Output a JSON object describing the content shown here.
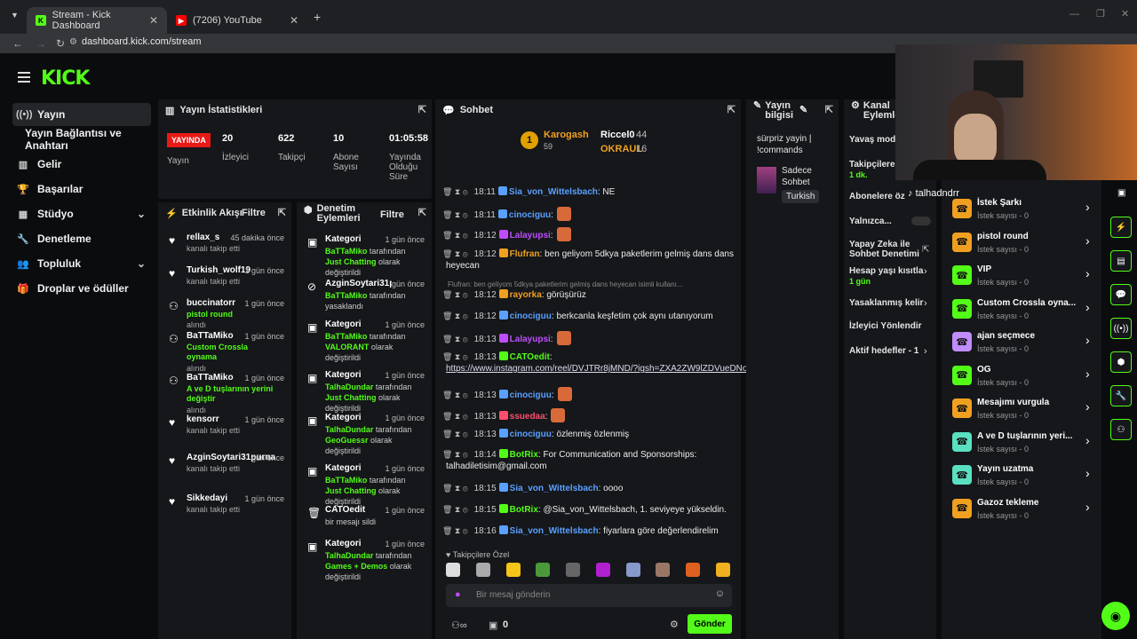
{
  "browser": {
    "tabs": [
      {
        "title": "Stream - Kick Dashboard"
      },
      {
        "title": "(7206) YouTube"
      }
    ],
    "url": "dashboard.kick.com/stream"
  },
  "brand": {
    "logo": "KICK",
    "accent": "#53fc18"
  },
  "nav": {
    "items": [
      {
        "label": "Yayın",
        "icon": "broadcast-icon"
      },
      {
        "label": "Yayın Bağlantısı ve Anahtarı"
      },
      {
        "label": "Gelir",
        "icon": "revenue-icon"
      },
      {
        "label": "Başarılar",
        "icon": "trophy-icon"
      },
      {
        "label": "Stüdyo",
        "icon": "studio-icon"
      },
      {
        "label": "Denetleme",
        "icon": "wrench-icon"
      },
      {
        "label": "Topluluk",
        "icon": "community-icon"
      },
      {
        "label": "Droplar ve ödüller",
        "icon": "gift-icon"
      }
    ]
  },
  "stats": {
    "title": "Yayın İstatistikleri",
    "live_label": "YAYINDA",
    "live_sub": "Yayın",
    "viewers": "20",
    "viewers_label": "İzleyici",
    "followers": "622",
    "followers_label": "Takipçi",
    "subs": "10",
    "subs_label": "Abone Sayısı",
    "uptime": "01:05:58",
    "uptime_label": "Yayında Olduğu Süre"
  },
  "activity": {
    "title": "Etkinlik Akışı",
    "filter": "Filtre",
    "items": [
      {
        "name": "rellax_s",
        "time": "45 dakika önce",
        "sub": "kanalı takip etti"
      },
      {
        "name": "Turkish_wolf19",
        "time": "1 gün önce",
        "sub": "kanalı takip etti"
      },
      {
        "name": "buccinatorr",
        "time": "1 gün önce",
        "reward": "pistol round",
        "sub": "alındı"
      },
      {
        "name": "BaTTaMiko",
        "time": "1 gün önce",
        "reward": "Custom Crossla oynama",
        "sub": "alındı"
      },
      {
        "name": "BaTTaMiko",
        "time": "1 gün önce",
        "reward": "A ve D tuşlarının yerini değiştir",
        "sub": "alındı"
      },
      {
        "name": "kensorr",
        "time": "1 gün önce",
        "sub": "kanalı takip etti"
      },
      {
        "name": "AzginSoytari31purna",
        "time": "gün önce",
        "sub": "kanalı takip etti"
      },
      {
        "name": "Sikkedayi",
        "time": "1 gün önce",
        "sub": "kanalı takip etti"
      }
    ]
  },
  "moderation": {
    "title": "Denetim Eylemleri",
    "filter": "Filtre",
    "items": [
      {
        "title": "Kategori",
        "time": "1 gün önce",
        "who": "BaTTaMiko",
        "mid": " tarafından ",
        "val": "Just Chatting",
        "end": " olarak değiştirildi"
      },
      {
        "title": "AzginSoytari31purna",
        "time": "gün önce",
        "who": "BaTTaMiko",
        "mid": " tarafından yasaklandı",
        "val": "",
        "end": ""
      },
      {
        "title": "Kategori",
        "time": "1 gün önce",
        "who": "BaTTaMiko",
        "mid": " tarafından ",
        "val": "VALORANT",
        "end": " olarak değiştirildi"
      },
      {
        "title": "Kategori",
        "time": "1 gün önce",
        "who": "TalhaDundar",
        "mid": " tarafından ",
        "val": "Just Chatting",
        "end": " olarak değiştirildi"
      },
      {
        "title": "Kategori",
        "time": "1 gün önce",
        "who": "TalhaDundar",
        "mid": " tarafından ",
        "val": "GeoGuessr",
        "end": " olarak değiştirildi"
      },
      {
        "title": "Kategori",
        "time": "1 gün önce",
        "who": "BaTTaMiko",
        "mid": " tarafından ",
        "val": "Just Chatting",
        "end": " olarak değiştirildi"
      },
      {
        "title": "CATOedit",
        "time": "1 gün önce",
        "who": "",
        "mid": "bir mesajı sildi",
        "val": "",
        "end": ""
      },
      {
        "title": "Kategori",
        "time": "1 gün önce",
        "who": "TalhaDundar",
        "mid": " tarafından ",
        "val": "Games + Demos",
        "end": " olarak değiştirildi"
      }
    ]
  },
  "chat": {
    "title": "Sohbet",
    "top": [
      {
        "name": "Karogash",
        "count": "59"
      },
      {
        "name": "Riccel0",
        "count": "44"
      },
      {
        "name": "OKRAUL",
        "count": "16"
      }
    ],
    "messages": [
      {
        "time": "18:11",
        "user": "Sia_von_Wittelsbach",
        "color": "#5aa0ff",
        "text": ": NE"
      },
      {
        "time": "18:11",
        "user": "cinociguu",
        "color": "#5aa0ff",
        "text": ":"
      },
      {
        "time": "18:12",
        "user": "Lalayupsi",
        "color": "#c04cff",
        "text": ":"
      },
      {
        "time": "18:12",
        "user": "Flufran",
        "color": "#f0a020",
        "text": ": ben geliyom 5dkya paketlerim gelmiş dans dans",
        "text2": "heyecan"
      },
      {
        "time": "18:12",
        "user": "rayorka",
        "color": "#f0a020",
        "text": ": görüşürüz"
      },
      {
        "time": "18:12",
        "user": "cinociguu",
        "color": "#5aa0ff",
        "text": ": berkcanla keşfetim çok aynı utanıyorum"
      },
      {
        "time": "18:13",
        "user": "Lalayupsi",
        "color": "#c04cff",
        "text": ":"
      },
      {
        "time": "18:13",
        "user": "CATOedit",
        "color": "#53fc18",
        "text": ":",
        "text2": "https://www.instagram.com/reel/DVJTRr8jMND/?igsh=ZXA2ZW9lZDVueDNo"
      },
      {
        "time": "18:13",
        "user": "cinociguu",
        "color": "#5aa0ff",
        "text": ":"
      },
      {
        "time": "18:13",
        "user": "ssuedaa",
        "color": "#ff4d6d",
        "text": ":"
      },
      {
        "time": "18:13",
        "user": "cinociguu",
        "color": "#5aa0ff",
        "text": ": özlenmiş özlenmiş"
      },
      {
        "time": "18:14",
        "user": "BotRix",
        "color": "#53fc18",
        "text": ": For Communication and Sponsorships:",
        "text2": "talhadiletisim@gmail.com"
      },
      {
        "time": "18:15",
        "user": "Sia_von_Wittelsbach",
        "color": "#5aa0ff",
        "text": ": oooo"
      },
      {
        "time": "18:15",
        "user": "BotRix",
        "color": "#53fc18",
        "text": ": @Sia_von_Wittelsbach, 1. seviyeye yükseldin."
      },
      {
        "time": "18:16",
        "user": "Sia_von_Wittelsbach",
        "color": "#5aa0ff",
        "text": ": fiyarlara göre değerlendirelim"
      }
    ],
    "reply_preview": "Flufran: ben geliyom 5dkya paketlerim gelmiş dans heyecan isimli kullanı...",
    "followers_only": "Takipçilere Özel",
    "input_placeholder": "Bir mesaj gönderin",
    "send": "Gönder",
    "points": "0"
  },
  "stream_info": {
    "title": "Yayın bilgisi",
    "stream_title": "sürpriz yayin | !commands",
    "chat_mode": "Sadece Sohbet",
    "language": "Turkish"
  },
  "channel_actions": {
    "title": "Kanal Eylemleri",
    "items": [
      {
        "label": "Yavaş mod"
      },
      {
        "label": "Takipçilere",
        "sub": "1 dk."
      },
      {
        "label": "Abonelere öz"
      },
      {
        "label": "Yalnızca..."
      },
      {
        "label": "Yapay Zeka ile Sohbet Denetimi"
      },
      {
        "label": "Hesap yaşı kısıtla",
        "sub": "1 gün"
      },
      {
        "label": "Yasaklanmış kelir"
      },
      {
        "label": "İzleyici Yönlendir"
      },
      {
        "label": "Aktif hedefler - 1"
      }
    ]
  },
  "rewards": {
    "items": [
      {
        "title": "İstek Şarkı",
        "sub": "İstek sayısı - 0",
        "color": "#f0a020"
      },
      {
        "title": "pistol round",
        "sub": "İstek sayısı - 0",
        "color": "#f0a020"
      },
      {
        "title": "VIP",
        "sub": "İstek sayısı - 0",
        "color": "#53fc18"
      },
      {
        "title": "Custom Crossla oyna...",
        "sub": "İstek sayısı - 0",
        "color": "#53fc18"
      },
      {
        "title": "ajan seçmece",
        "sub": "İstek sayısı - 0",
        "color": "#c08cff"
      },
      {
        "title": "OG",
        "sub": "İstek sayısı - 0",
        "color": "#53fc18"
      },
      {
        "title": "Mesajımı vurgula",
        "sub": "İstek sayısı - 0",
        "color": "#f0a020"
      },
      {
        "title": "A ve D tuşlarının yeri...",
        "sub": "İstek sayısı - 0",
        "color": "#5ae0c0"
      },
      {
        "title": "Yayın uzatma",
        "sub": "İstek sayısı - 0",
        "color": "#5ae0c0"
      },
      {
        "title": "Gazoz tekleme",
        "sub": "İstek sayısı - 0",
        "color": "#f0a020"
      }
    ]
  },
  "webcam": {
    "watermark": "talhadndrr"
  }
}
